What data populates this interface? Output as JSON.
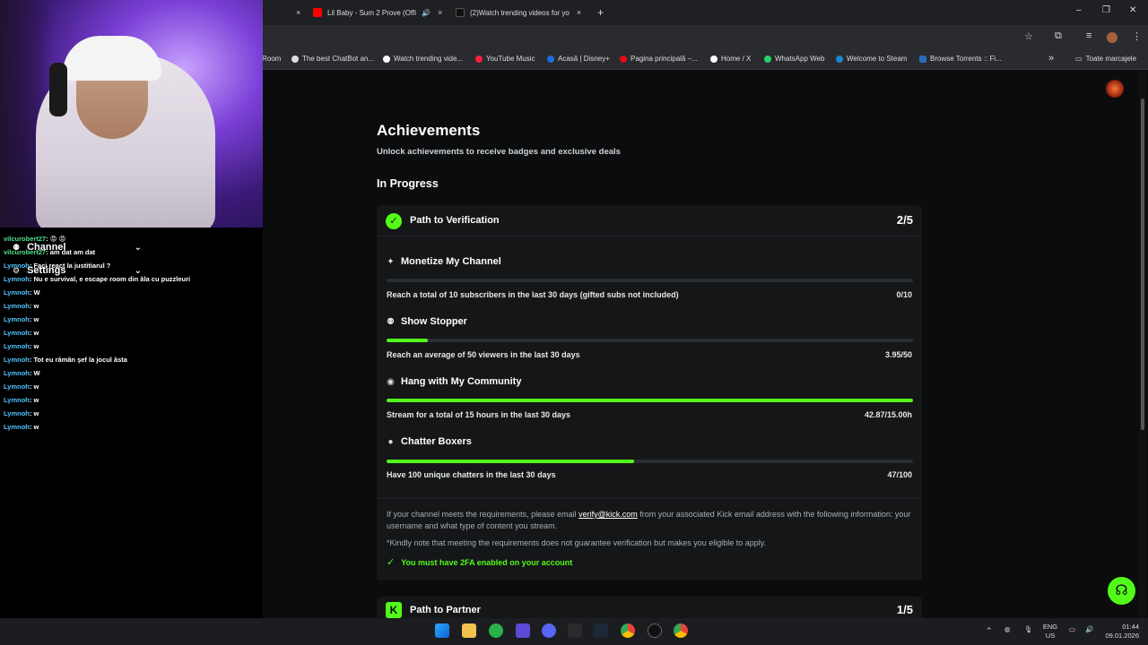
{
  "browser": {
    "tabs": [
      {
        "title": "Lil Baby - Sum 2 Prove (Offi",
        "close": "×"
      },
      {
        "title": "(2)Watch trending videos for yo",
        "close": "×"
      }
    ],
    "first_tab_close": "×",
    "new_tab": "+",
    "window_controls": {
      "minimize": "–",
      "maximize": "❐",
      "close": "✕"
    },
    "bookmarks": [
      "Room",
      "The best ChatBot an...",
      "Watch trending vide...",
      "YouTube Music",
      "Acasă | Disney+",
      "Pagina principală –...",
      "Home / X",
      "WhatsApp Web",
      "Welcome to Steam",
      "Browse Torrents :: Fi..."
    ],
    "bookmarks_more": "»",
    "all_bookmarks": "Toate marcajele"
  },
  "chat_menu": {
    "channel": "Channel",
    "settings": "Settings"
  },
  "chat": [
    {
      "user": "vilcurobert27",
      "message": ": 😡 😡"
    },
    {
      "user": "vilcurobert27",
      "message": ": am dat am dat"
    },
    {
      "user": "Lymnoh",
      "message": ": Faci react la justitiarul ?"
    },
    {
      "user": "Lymnoh",
      "message": ": Nu e survival, e escape room din ăla cu puzzleuri"
    },
    {
      "user": "Lymnoh",
      "message": ": W"
    },
    {
      "user": "Lymnoh",
      "message": ": w"
    },
    {
      "user": "Lymnoh",
      "message": ": w"
    },
    {
      "user": "Lymnoh",
      "message": ": w"
    },
    {
      "user": "Lymnoh",
      "message": ": w"
    },
    {
      "user": "Lymnoh",
      "message": ": Tot eu rămân şef la jocul ăsta"
    },
    {
      "user": "Lymnoh",
      "message": ": W"
    },
    {
      "user": "Lymnoh",
      "message": ": w"
    },
    {
      "user": "Lymnoh",
      "message": ": w"
    },
    {
      "user": "Lymnoh",
      "message": ": w"
    },
    {
      "user": "Lymnoh",
      "message": ": w"
    }
  ],
  "page": {
    "title": "Achievements",
    "subtitle": "Unlock achievements to receive badges and exclusive deals",
    "section": "In Progress"
  },
  "verification": {
    "title": "Path to Verification",
    "count": "2/5",
    "achievements": [
      {
        "name": "Monetize My Channel",
        "icon": "sparkle-icon",
        "desc": "Reach a total of 10 subscribers in the last 30 days (gifted subs not included)",
        "value": "0/10",
        "progress": 0
      },
      {
        "name": "Show Stopper",
        "icon": "people-icon",
        "desc": "Reach an average of 50 viewers in the last 30 days",
        "value": "3.95/50",
        "progress": 0.079
      },
      {
        "name": "Hang with My Community",
        "icon": "broadcast-icon",
        "desc": "Stream for a total of 15 hours in the last 30 days",
        "value": "42.87/15.00h",
        "progress": 1
      },
      {
        "name": "Chatter Boxers",
        "icon": "chat-bubble-icon",
        "desc": "Have 100 unique chatters in the last 30 days",
        "value": "47/100",
        "progress": 0.47
      }
    ],
    "note_prefix": "If your channel meets the requirements, please email ",
    "note_email": "verify@kick.com",
    "note_suffix": " from your associated Kick email address with the following information: your username and what type of content you stream.",
    "disclaimer": "*Kindly note that meeting the requirements does not guarantee verification but makes you eligible to apply.",
    "requirement": "You must have 2FA enabled on your account"
  },
  "partner": {
    "title": "Path to Partner",
    "count": "1/5"
  },
  "taskbar": {
    "lang": "ENG",
    "region": "US",
    "time": "01:44",
    "date": "09.01.2026"
  },
  "colors": {
    "accent": "#53fc18",
    "background": "#0b0c0d",
    "card": "#141618"
  }
}
